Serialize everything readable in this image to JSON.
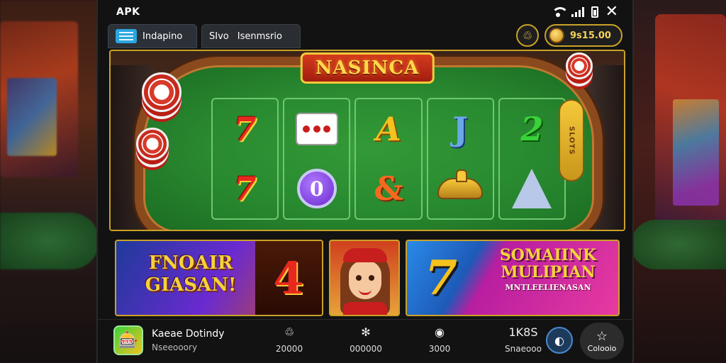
{
  "status": {
    "title": "APK"
  },
  "tabs": [
    {
      "label": "Indapino"
    },
    {
      "label_a": "SIvo",
      "label_b": "Isenmsrio"
    }
  ],
  "balance": {
    "amount": "9s15.00"
  },
  "game": {
    "title": "NASINCA",
    "side_tab": "SLOTS",
    "reels": [
      {
        "top": "7",
        "bottom": "7"
      },
      {
        "top": "dice",
        "bottom": "0"
      },
      {
        "top": "A",
        "bottom": "&"
      },
      {
        "top": "J",
        "bottom": "lamp"
      },
      {
        "top": "2",
        "bottom": "card"
      }
    ]
  },
  "promos": {
    "first": {
      "text": "FNOAIR GIASAN!",
      "number": "4"
    },
    "third": {
      "number": "7",
      "text": "SOMAIINK MULIPIAN",
      "sub": "MNTLEELIENASAN"
    }
  },
  "app": {
    "name": "Kaeae Dotindy",
    "category": "Nseeooory",
    "stats": [
      {
        "icon": "recycle-icon",
        "symbol": "♲",
        "value": "20000"
      },
      {
        "icon": "split-icon",
        "symbol": "✻",
        "value": "000000"
      },
      {
        "icon": "pin-icon",
        "symbol": "◉",
        "value": "3000"
      },
      {
        "icon": "size-icon",
        "symbol": "",
        "label": "1K8S",
        "value": "Snaeooo"
      }
    ],
    "round_button": "◐",
    "fav": {
      "symbol": "☆",
      "label": "Colooio"
    }
  },
  "colors": {
    "accent_gold": "#c9a227",
    "felt_green": "#2a8a30",
    "wood_brown": "#8a4a1e"
  }
}
